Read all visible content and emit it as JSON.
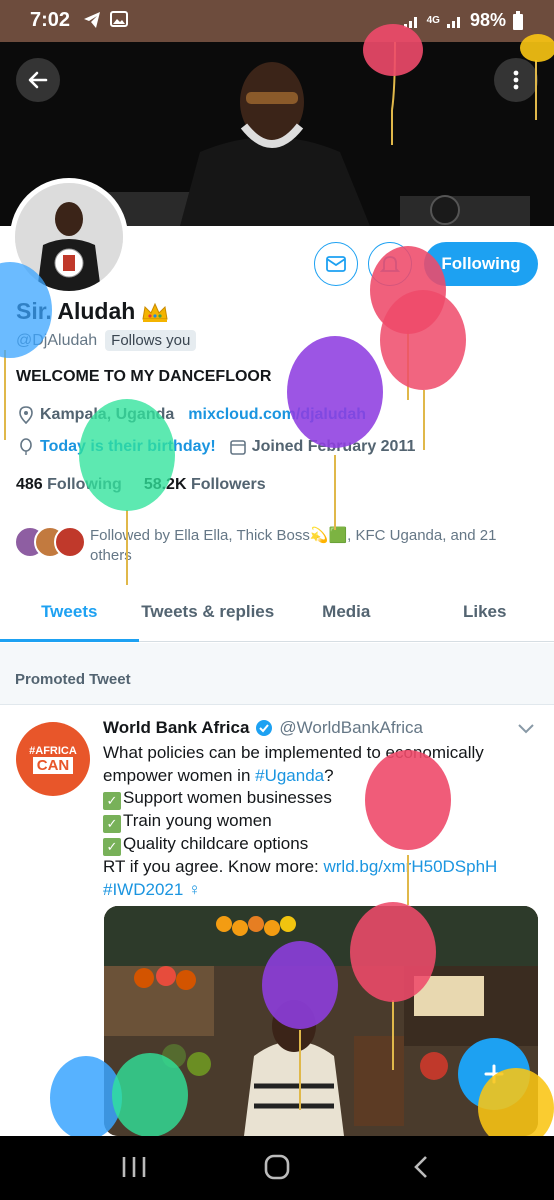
{
  "status_bar": {
    "time": "7:02",
    "network": "4G",
    "battery": "98%"
  },
  "profile": {
    "name": "Sir. Aludah",
    "handle": "@DjAludah",
    "follows_you": "Follows you",
    "bio": "WELCOME TO MY DANCEFLOOR",
    "location": "Kampala, Uganda",
    "website": "mixcloud.com/djaludah",
    "birthday": "Today is their birthday!",
    "joined": "Joined February 2011",
    "following_count": "486",
    "following_label": "Following",
    "followers_count": "58.2K",
    "followers_label": "Followers",
    "followed_by": "Followed by Ella Ella, Thick Boss💫🟩, KFC Uganda, and 21 others",
    "follow_button": "Following"
  },
  "tabs": [
    {
      "label": "Tweets",
      "active": true
    },
    {
      "label": "Tweets & replies",
      "active": false
    },
    {
      "label": "Media",
      "active": false
    },
    {
      "label": "Likes",
      "active": false
    }
  ],
  "promoted": {
    "label": "Promoted Tweet"
  },
  "tweet": {
    "author": "World Bank Africa",
    "handle": "@WorldBankAfrica",
    "avatar_line1": "#AFRICA",
    "avatar_line2": "CAN",
    "line1": "What policies can be implemented to economically",
    "line2_pre": "empower women in ",
    "line2_tag": "#Uganda",
    "line2_post": "?",
    "line3": "Support women businesses",
    "line4": "Train young women",
    "line5": "Quality childcare options",
    "line6_pre": "RT if you agree. Know more: ",
    "line6_link": "wrld.bg/xmrH50DSphH",
    "line7_tag": "#IWD2021",
    "line7_symbol": "♀"
  },
  "colors": {
    "accent": "#1da1f2",
    "status_bar": "#6d4c3d",
    "africa_can": "#e8562a"
  },
  "icons": {
    "back": "arrow-left-icon",
    "more": "more-vertical-icon",
    "mail": "mail-icon",
    "bell": "bell-icon",
    "location": "location-pin-icon",
    "birthday": "balloon-icon",
    "calendar": "calendar-icon",
    "verified": "verified-badge-icon",
    "chevron": "chevron-down-icon",
    "compose": "compose-plus-icon"
  }
}
